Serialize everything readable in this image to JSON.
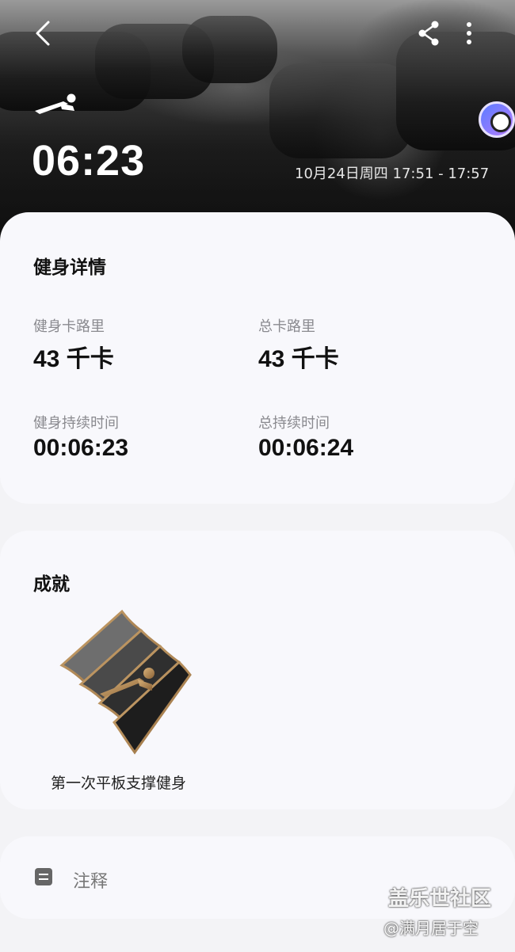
{
  "header": {
    "duration": "06:23",
    "datetime": "10月24日周四 17:51 - 17:57",
    "icons": {
      "back": "chevron-left-icon",
      "share": "share-icon",
      "more": "more-vertical-icon",
      "activity": "plank-icon",
      "assistant": "assistant-bubble-icon"
    }
  },
  "details": {
    "title": "健身详情",
    "stats": [
      {
        "label": "健身卡路里",
        "value": "43 千卡"
      },
      {
        "label": "总卡路里",
        "value": "43 千卡"
      },
      {
        "label": "健身持续时间",
        "value": "00:06:23"
      },
      {
        "label": "总持续时间",
        "value": "00:06:24"
      }
    ]
  },
  "achievements": {
    "title": "成就",
    "badge": {
      "name": "第一次平板支撑健身",
      "icon": "plank-badge-icon"
    }
  },
  "notes": {
    "label": "注释",
    "icon": "note-icon"
  },
  "watermark": {
    "title": "盖乐世社区",
    "user": "@满月居于空"
  },
  "colors": {
    "hero_dark": "#141414",
    "card_bg": "#f8f8fc",
    "page_bg": "#f3f3f6",
    "label_gray": "#8a8a8f"
  }
}
